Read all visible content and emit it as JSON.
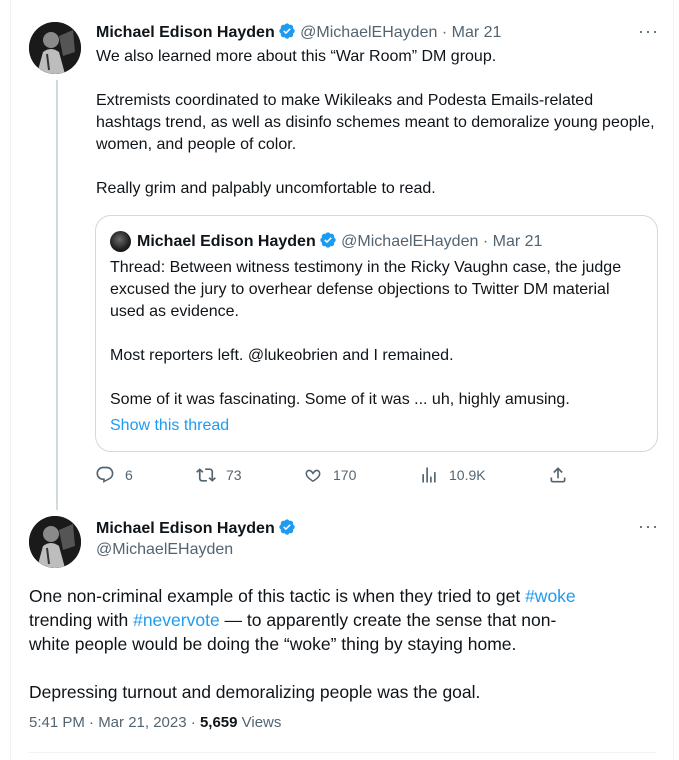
{
  "tweet1": {
    "author_name": "Michael Edison Hayden",
    "handle": "@MichaelEHayden",
    "sep": "·",
    "date": "Mar 21",
    "more": "···",
    "text": "We also learned more about this “War Room” DM group.\n\nExtremists coordinated to make Wikileaks and Podesta Emails-related hashtags trend, as well as disinfo schemes meant to demoralize young people, women, and people of color.\n\nReally grim and palpably uncomfortable to read.",
    "quote": {
      "author_name": "Michael Edison Hayden",
      "handle": "@MichaelEHayden",
      "sep": "·",
      "date": "Mar 21",
      "text": "Thread: Between witness testimony in the Ricky Vaughn case, the judge excused the jury to overhear defense objections to Twitter DM material used as evidence.\n\nMost reporters left. @lukeobrien and I remained.\n\nSome of it was fascinating. Some of it was ... uh, highly amusing.",
      "show_thread": "Show this thread"
    },
    "actions": {
      "reply_count": "6",
      "retweet_count": "73",
      "like_count": "170",
      "views_count": "10.9K"
    }
  },
  "tweet2": {
    "author_name": "Michael Edison Hayden",
    "handle": "@MichaelEHayden",
    "more": "···",
    "text_part1": "One non-criminal example of this tactic is when they tried to get ",
    "hashtag1": "#woke",
    "text_part2": "\ntrending with ",
    "hashtag2": "#nevervote",
    "text_part3": " — to apparently create the sense that non-\nwhite people would be doing the “woke” thing by staying home.\n\nDepressing turnout and demoralizing people was the goal.",
    "timestamp": "5:41 PM · Mar 21, 2023",
    "meta_sep": " · ",
    "views_count": "5,659",
    "views_label": " Views"
  },
  "colors": {
    "accent": "#1d9bf0",
    "text": "#0f1419",
    "secondary": "#536471",
    "border": "#cfd9de"
  },
  "icons": [
    "verified-badge-icon",
    "reply-icon",
    "retweet-icon",
    "like-icon",
    "views-icon",
    "share-icon",
    "more-icon"
  ]
}
